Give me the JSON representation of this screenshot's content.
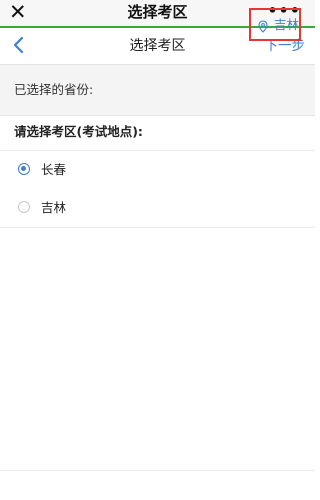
{
  "wechat_bar": {
    "close_icon": "close-icon",
    "title": "选择考区",
    "more_icon": "more-dots-icon",
    "more_text": "•••"
  },
  "nav": {
    "back_icon": "chevron-left-icon",
    "title": "选择考区",
    "next_label": "下一步"
  },
  "province": {
    "label": "已选择的省份:",
    "pin_icon": "location-pin-icon",
    "value": "吉林"
  },
  "section": {
    "title": "请选择考区(考试地点):"
  },
  "options": [
    {
      "label": "长春",
      "selected": true
    },
    {
      "label": "吉林",
      "selected": false
    }
  ],
  "colors": {
    "accent": "#3d7fd6",
    "highlight_border": "#e53535",
    "wechat_progress": "#3aab3a"
  }
}
